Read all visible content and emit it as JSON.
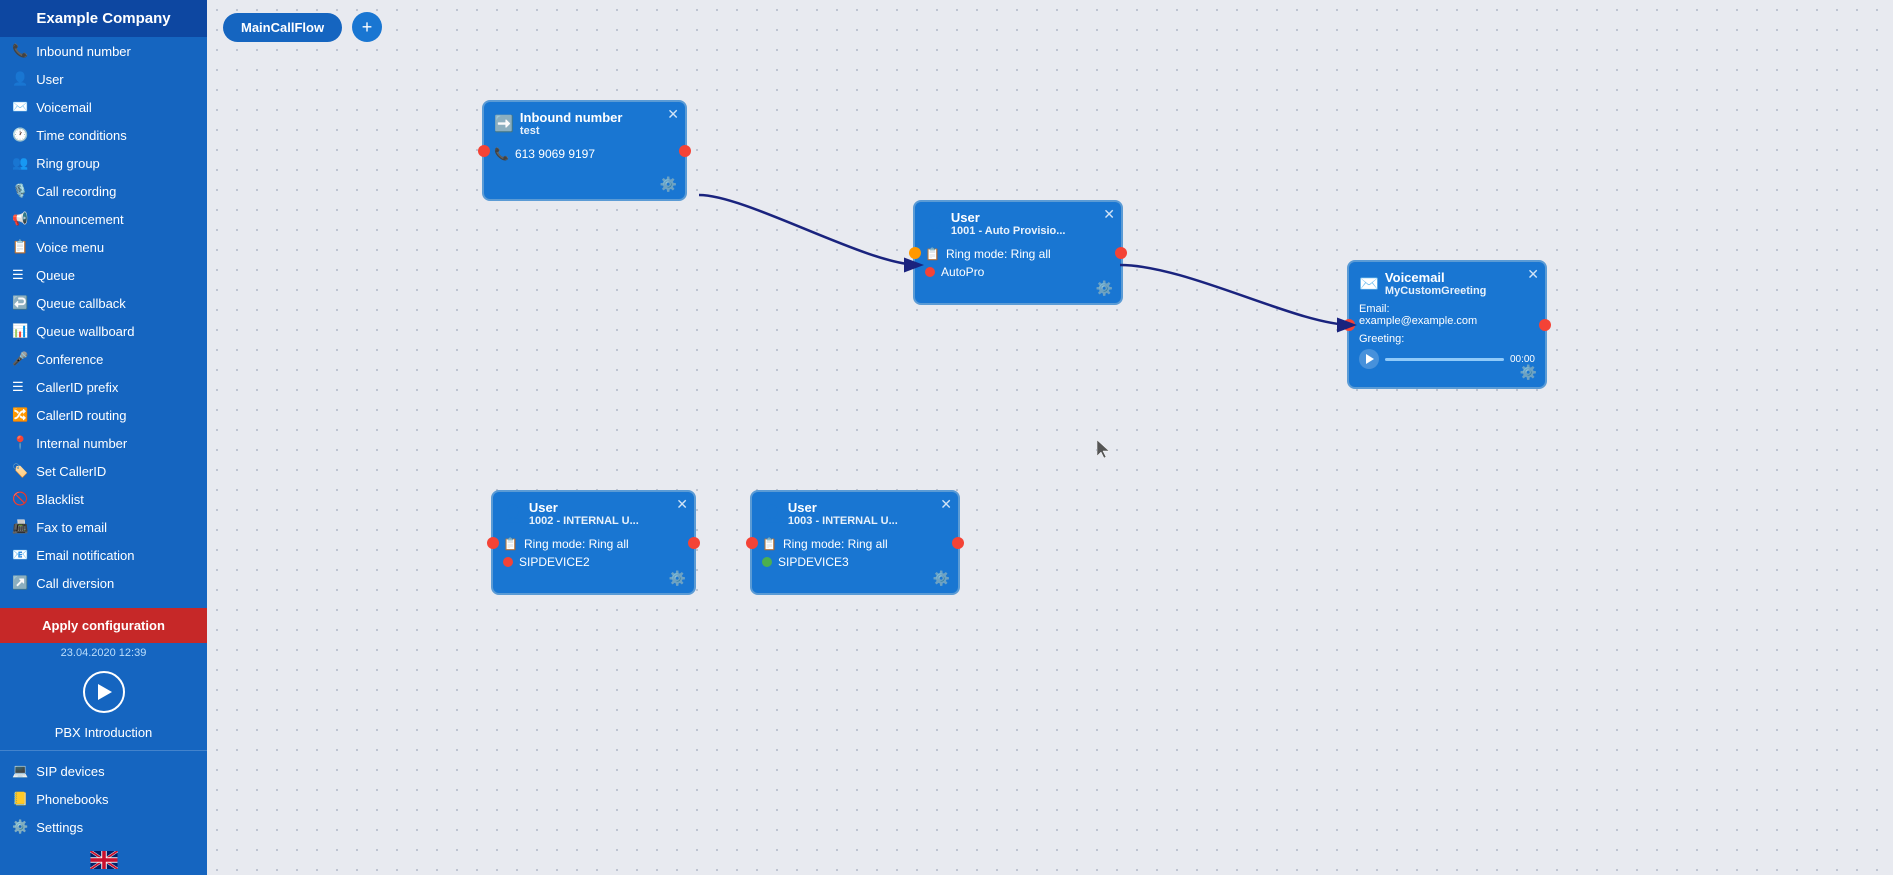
{
  "company": "Example Company",
  "sidebar": {
    "items": [
      {
        "label": "Inbound number",
        "icon": "📞"
      },
      {
        "label": "User",
        "icon": "👤"
      },
      {
        "label": "Voicemail",
        "icon": "✉️"
      },
      {
        "label": "Time conditions",
        "icon": "🕐"
      },
      {
        "label": "Ring group",
        "icon": "👥"
      },
      {
        "label": "Call recording",
        "icon": "🎙️"
      },
      {
        "label": "Announcement",
        "icon": "📢"
      },
      {
        "label": "Voice menu",
        "icon": "📋"
      },
      {
        "label": "Queue",
        "icon": "☰"
      },
      {
        "label": "Queue callback",
        "icon": "↩️"
      },
      {
        "label": "Queue wallboard",
        "icon": "📊"
      },
      {
        "label": "Conference",
        "icon": "🎤"
      },
      {
        "label": "CallerID prefix",
        "icon": "☰"
      },
      {
        "label": "CallerID routing",
        "icon": "🔀"
      },
      {
        "label": "Internal number",
        "icon": "📍"
      },
      {
        "label": "Set CallerID",
        "icon": "🏷️"
      },
      {
        "label": "Blacklist",
        "icon": "🚫"
      },
      {
        "label": "Fax to email",
        "icon": "📠"
      },
      {
        "label": "Email notification",
        "icon": "📧"
      },
      {
        "label": "Call diversion",
        "icon": "↗️"
      }
    ],
    "apply_config": "Apply configuration",
    "timestamp": "23.04.2020 12:39",
    "pbx_label": "PBX Introduction",
    "bottom_items": [
      {
        "label": "SIP devices",
        "icon": "💻"
      },
      {
        "label": "Phonebooks",
        "icon": "📒"
      },
      {
        "label": "Settings",
        "icon": "⚙️"
      }
    ]
  },
  "topbar": {
    "flow_label": "MainCallFlow",
    "add_button": "+"
  },
  "nodes": {
    "inbound": {
      "title": "Inbound number",
      "subtitle": "test",
      "phone": "613 9069 9197",
      "icon": "➡️"
    },
    "user1": {
      "title": "User",
      "subtitle": "1001 - Auto Provisio...",
      "ring_mode": "Ring mode: Ring all",
      "status_label": "AutoPro",
      "status_color": "red"
    },
    "voicemail": {
      "title": "Voicemail",
      "subtitle": "MyCustomGreeting",
      "email_label": "Email:",
      "email": "example@example.com",
      "greeting_label": "Greeting:",
      "time": "00:00",
      "icon": "✉️"
    },
    "user2": {
      "title": "User",
      "subtitle": "1002 - INTERNAL U...",
      "ring_mode": "Ring mode: Ring all",
      "status_label": "SIPDEVICE2",
      "status_color": "red"
    },
    "user3": {
      "title": "User",
      "subtitle": "1003 - INTERNAL U...",
      "ring_mode": "Ring mode: Ring all",
      "status_label": "SIPDEVICE3",
      "status_color": "green"
    }
  },
  "colors": {
    "sidebar_bg": "#1565c0",
    "sidebar_header": "#0d47a1",
    "node_bg": "#1976d2",
    "apply_btn": "#c62828",
    "accent": "#1565c0"
  }
}
